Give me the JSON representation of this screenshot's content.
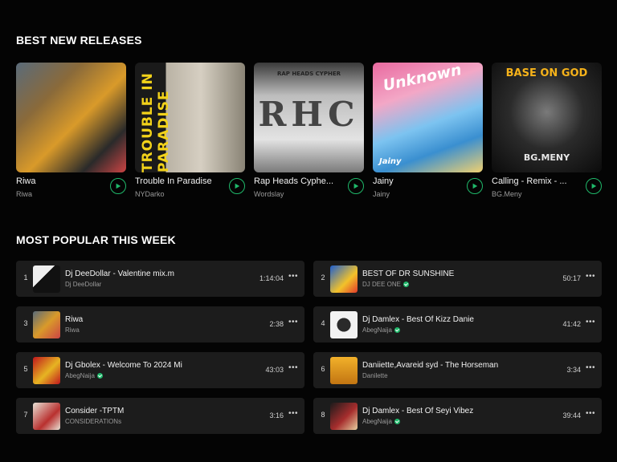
{
  "sections": {
    "new_releases_title": "BEST NEW RELEASES",
    "popular_title": "MOST POPULAR THIS WEEK"
  },
  "releases": [
    {
      "title": "Riwa",
      "artist": "Riwa",
      "cover_text": ""
    },
    {
      "title": "Trouble In Paradise",
      "artist": "NYDarko",
      "cover_text": "TROUBLE IN PARADISE"
    },
    {
      "title": "Rap Heads Cyphe...",
      "artist": "Wordslay",
      "cover_text": "RAP HEADS CYPHER"
    },
    {
      "title": "Jainy",
      "artist": "Jainy",
      "cover_text": "Unknown"
    },
    {
      "title": "Calling - Remix - ...",
      "artist": "BG.Meny",
      "cover_text": "BASE ON GOD"
    }
  ],
  "cover_extras": {
    "c3_big": "RHC",
    "c4_small": "Jainy",
    "c5_bottom": "BG.MENY"
  },
  "popular": [
    {
      "rank": "1",
      "title": "Dj DeeDollar - Valentine mix.m",
      "artist": "Dj DeeDollar",
      "verified": false,
      "duration": "1:14:04"
    },
    {
      "rank": "2",
      "title": "BEST OF DR SUNSHINE",
      "artist": "DJ DEE ONE",
      "verified": true,
      "duration": "50:17"
    },
    {
      "rank": "3",
      "title": "Riwa",
      "artist": "Riwa",
      "verified": false,
      "duration": "2:38"
    },
    {
      "rank": "4",
      "title": "Dj Damlex - Best Of Kizz Danie",
      "artist": "AbegNaija",
      "verified": true,
      "duration": "41:42"
    },
    {
      "rank": "5",
      "title": "Dj Gbolex - Welcome To 2024 Mi",
      "artist": "AbegNaija",
      "verified": true,
      "duration": "43:03"
    },
    {
      "rank": "6",
      "title": "Daniiette,Avareid syd - The Horseman",
      "artist": "Danilette",
      "verified": false,
      "duration": "3:34"
    },
    {
      "rank": "7",
      "title": "Consider -TPTM",
      "artist": "CONSIDERATIONs",
      "verified": false,
      "duration": "3:16"
    },
    {
      "rank": "8",
      "title": "Dj Damlex - Best Of Seyi Vibez",
      "artist": "AbegNaija",
      "verified": true,
      "duration": "39:44"
    }
  ],
  "more_label": "•••",
  "colors": {
    "accent": "#1fb86a",
    "background": "#040404",
    "row_bg": "#1c1c1c"
  }
}
